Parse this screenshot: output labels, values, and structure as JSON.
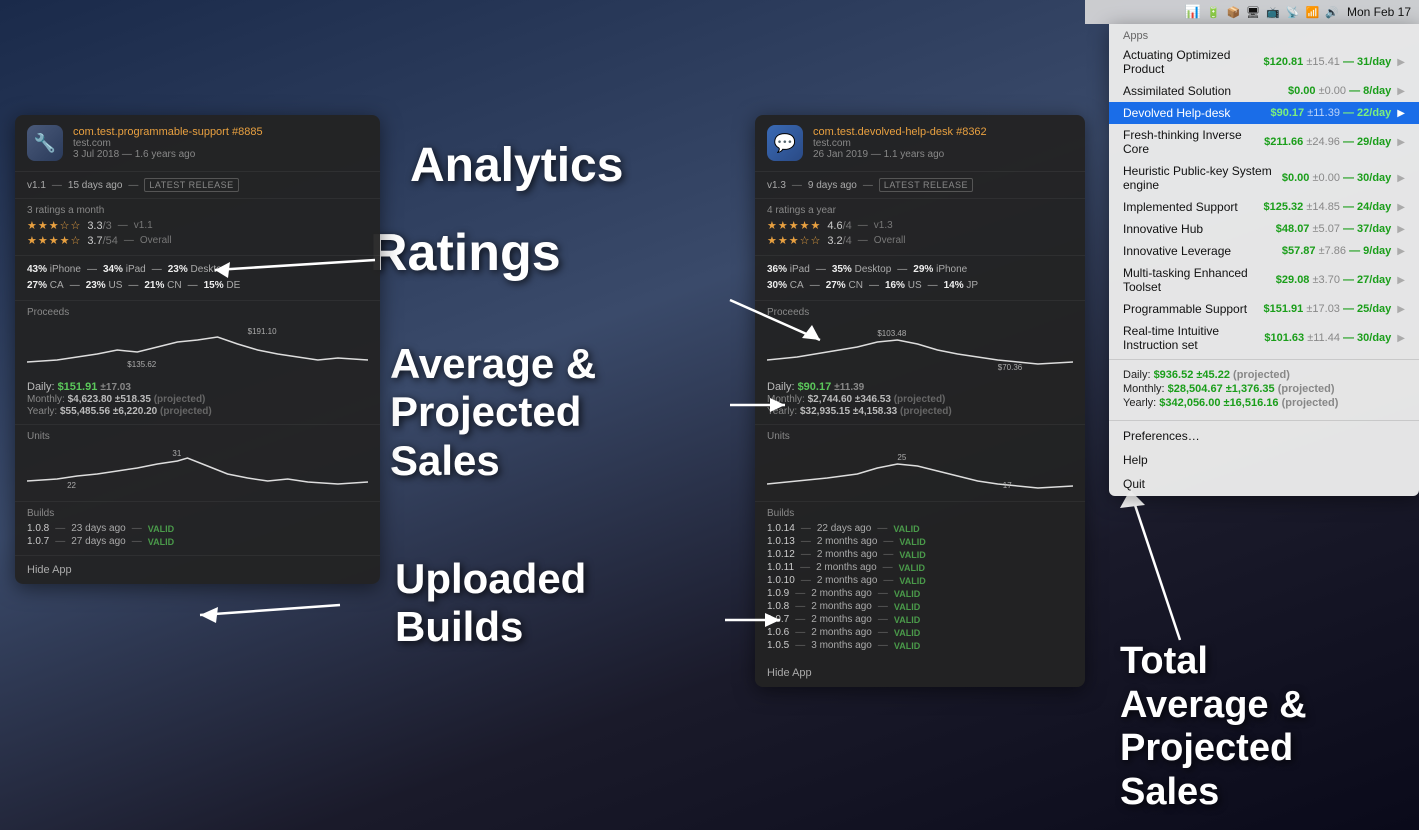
{
  "menubar": {
    "time": "Mon Feb 17",
    "icons": [
      "📊",
      "📱",
      "📦",
      "🖥",
      "📶",
      "🔊"
    ]
  },
  "annotations": {
    "analytics": "Analytics",
    "ratings": "Ratings",
    "avgSales": "Average &\nProjected\nSales",
    "builds": "Uploaded\nBuilds",
    "totalSales": "Total\nAverage &\nProjected\nSales"
  },
  "card_left": {
    "bundle": "com.test.programmable-support",
    "issue": "#8885",
    "domain": "test.com",
    "date": "3 Jul 2018 — 1.6 years ago",
    "release": "v1.1",
    "release_age": "15 days ago",
    "release_label": "LATEST RELEASE",
    "ratings_period": "3 ratings a month",
    "rating_current": "3.3",
    "rating_current_denom": "/3",
    "rating_version": "v1.1",
    "rating_overall": "3.7",
    "rating_overall_denom": "/54",
    "rating_overall_label": "Overall",
    "geo_rows": [
      "43% iPhone — 34% iPad — 23% Desktop",
      "27% CA — 23% US — 21% CN — 15% DE"
    ],
    "proceeds_label": "Proceeds",
    "proceeds_high": "$191.10",
    "proceeds_low": "$135.62",
    "daily_val": "$151.91",
    "daily_err": "±17.03",
    "monthly_val": "$4,623.80",
    "monthly_err": "±518.35",
    "yearly_val": "$55,485.56",
    "yearly_err": "±6,220.20",
    "units_label": "Units",
    "units_high": "31",
    "units_low": "22",
    "builds_label": "Builds",
    "builds": [
      {
        "ver": "1.0.8",
        "age": "23 days ago",
        "status": "VALID"
      },
      {
        "ver": "1.0.7",
        "age": "27 days ago",
        "status": "VALID"
      }
    ],
    "hide_label": "Hide App"
  },
  "card_right": {
    "bundle": "com.test.devolved-help-desk",
    "issue": "#8362",
    "domain": "test.com",
    "date": "26 Jan 2019 — 1.1 years ago",
    "release": "v1.3",
    "release_age": "9 days ago",
    "release_label": "LATEST RELEASE",
    "ratings_period": "4 ratings a year",
    "rating_current": "4.6",
    "rating_current_denom": "/4",
    "rating_version": "v1.3",
    "rating_overall": "3.2",
    "rating_overall_denom": "/4",
    "rating_overall_label": "Overall",
    "geo_rows": [
      "36% iPad — 35% Desktop — 29% iPhone",
      "30% CA — 27% CN — 16% US — 14% JP"
    ],
    "proceeds_label": "Proceeds",
    "proceeds_high": "$103.48",
    "proceeds_low": "$70.36",
    "daily_val": "$90.17",
    "daily_err": "±11.39",
    "monthly_val": "$2,744.60",
    "monthly_err": "±346.53",
    "yearly_val": "$32,935.15",
    "yearly_err": "±4,158.33",
    "units_label": "Units",
    "units_high": "25",
    "units_low": "17",
    "builds_label": "Builds",
    "builds": [
      {
        "ver": "1.0.14",
        "age": "22 days ago",
        "status": "VALID"
      },
      {
        "ver": "1.0.13",
        "age": "2 months ago",
        "status": "VALID"
      },
      {
        "ver": "1.0.12",
        "age": "2 months ago",
        "status": "VALID"
      },
      {
        "ver": "1.0.11",
        "age": "2 months ago",
        "status": "VALID"
      },
      {
        "ver": "1.0.10",
        "age": "2 months ago",
        "status": "VALID"
      },
      {
        "ver": "1.0.9",
        "age": "2 months ago",
        "status": "VALID"
      },
      {
        "ver": "1.0.8",
        "age": "2 months ago",
        "status": "VALID"
      },
      {
        "ver": "1.0.7",
        "age": "2 months ago",
        "status": "VALID"
      },
      {
        "ver": "1.0.6",
        "age": "2 months ago",
        "status": "VALID"
      },
      {
        "ver": "1.0.5",
        "age": "3 months ago",
        "status": "VALID"
      }
    ],
    "hide_label": "Hide App"
  },
  "dropdown": {
    "section_label": "Apps",
    "items": [
      {
        "name": "Actuating Optimized Product",
        "price": "$120.81",
        "err": "±15.41",
        "rate": "31/day",
        "active": false
      },
      {
        "name": "Assimilated Solution",
        "price": "$0.00",
        "err": "±0.00",
        "rate": "8/day",
        "active": false
      },
      {
        "name": "Devolved Help-desk",
        "price": "$90.17",
        "err": "±11.39",
        "rate": "22/day",
        "active": true
      },
      {
        "name": "Fresh-thinking Inverse Core",
        "price": "$211.66",
        "err": "±24.96",
        "rate": "29/day",
        "active": false
      },
      {
        "name": "Heuristic Public-key System engine",
        "price": "$0.00",
        "err": "±0.00",
        "rate": "30/day",
        "active": false
      },
      {
        "name": "Implemented Support",
        "price": "$125.32",
        "err": "±14.85",
        "rate": "24/day",
        "active": false
      },
      {
        "name": "Innovative Hub",
        "price": "$48.07",
        "err": "±5.07",
        "rate": "37/day",
        "active": false
      },
      {
        "name": "Innovative Leverage",
        "price": "$57.87",
        "err": "±7.86",
        "rate": "9/day",
        "active": false
      },
      {
        "name": "Multi-tasking Enhanced Toolset",
        "price": "$29.08",
        "err": "±3.70",
        "rate": "27/day",
        "active": false
      },
      {
        "name": "Programmable Support",
        "price": "$151.91",
        "err": "±17.03",
        "rate": "25/day",
        "active": false
      },
      {
        "name": "Real-time Intuitive Instruction set",
        "price": "$101.63",
        "err": "±11.44",
        "rate": "30/day",
        "active": false
      }
    ],
    "total_daily": "$936.52",
    "total_daily_err": "±45.22",
    "total_monthly": "$28,504.67",
    "total_monthly_err": "±1,376.35",
    "total_yearly": "$342,056.00",
    "total_yearly_err": "±16,516.16",
    "preferences": "Preferences…",
    "help": "Help",
    "quit": "Quit"
  }
}
